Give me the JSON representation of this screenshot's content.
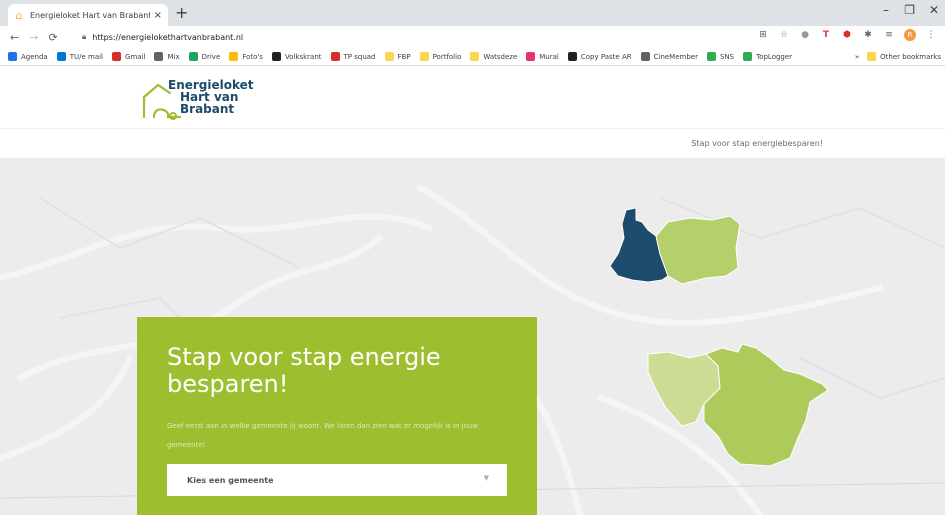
{
  "browser": {
    "tab_title": "Energieloket Hart van Brabant | E",
    "tab_close": "×",
    "new_tab": "+",
    "window_controls": [
      "–",
      "❐",
      "✕"
    ],
    "url": "https://energielokethartvanbrabant.nl",
    "profile_initial": "R"
  },
  "bookmarks": {
    "items": [
      {
        "label": "Agenda",
        "color": "#1a73e8"
      },
      {
        "label": "TU/e mail",
        "color": "#0078d4"
      },
      {
        "label": "Gmail",
        "color": "#d93025"
      },
      {
        "label": "Mix",
        "color": "#5f6368"
      },
      {
        "label": "Drive",
        "color": "#1fa463"
      },
      {
        "label": "Foto's",
        "color": "#fbbc04"
      },
      {
        "label": "Volkskrant",
        "color": "#202124"
      },
      {
        "label": "TP squad",
        "color": "#d93025"
      },
      {
        "label": "FBP",
        "color": "#f9d64e"
      },
      {
        "label": "Portfolio",
        "color": "#f9d64e"
      },
      {
        "label": "Watsdeze",
        "color": "#f9d64e"
      },
      {
        "label": "Mural",
        "color": "#e8336d"
      },
      {
        "label": "Copy Paste AR",
        "color": "#202124"
      },
      {
        "label": "CineMember",
        "color": "#5f6368"
      },
      {
        "label": "SNS",
        "color": "#34a853"
      },
      {
        "label": "TopLogger",
        "color": "#34a853"
      }
    ],
    "overflow": "»",
    "other": "Other bookmarks"
  },
  "site": {
    "logo_lines": [
      "Energieloket",
      "Hart van",
      "Brabant"
    ],
    "nav_link": "Stap voor stap energiebesparen!"
  },
  "hero": {
    "title": "Stap voor stap energie besparen!",
    "text": "Geef eerst aan in welke gemeente jij woont. We laten dan zien wat er mogelijk is in jouw gemeente!",
    "select_value": "Kies een gemeente"
  },
  "colors": {
    "accent_green": "#9dbe2e",
    "dark_blue": "#1c4b6b",
    "light_green": "#b5cf6a"
  }
}
